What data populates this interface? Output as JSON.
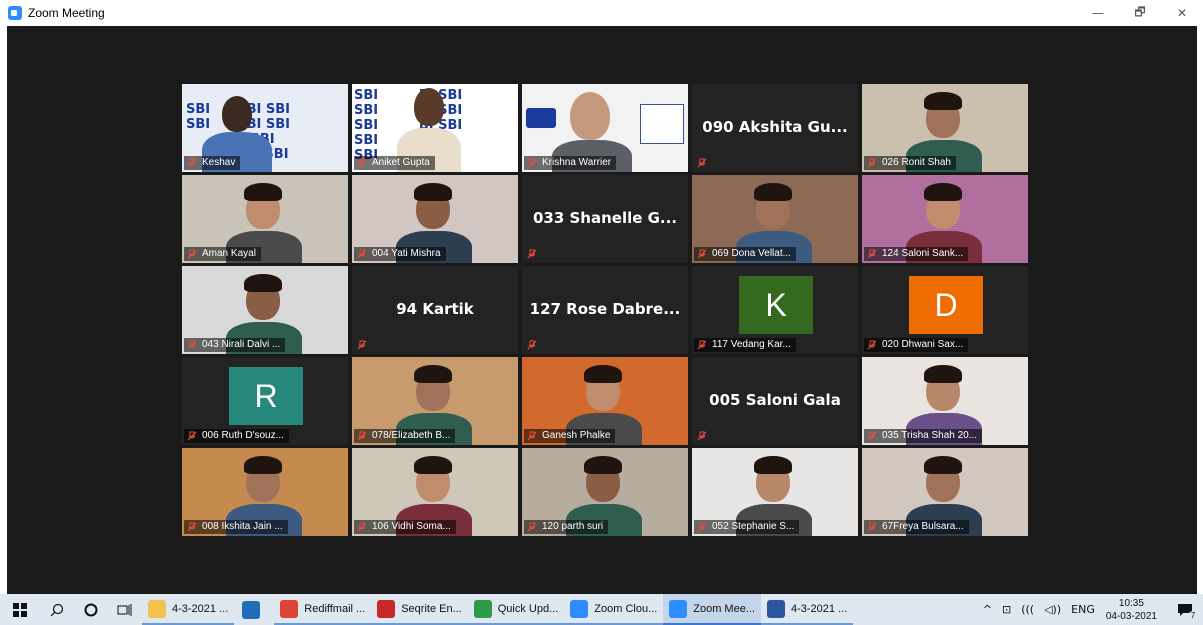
{
  "window": {
    "title": "Zoom Meeting",
    "minimize": "—",
    "restore": "🗗",
    "close": "✕"
  },
  "participants": [
    {
      "name": "Keshav",
      "type": "video",
      "bg": "#e8ecf4"
    },
    {
      "name": "Aniket Gupta",
      "type": "video",
      "bg": "#ffffff"
    },
    {
      "name": "Krishna Warrier",
      "type": "video",
      "bg": "#f2f2f2",
      "active": true
    },
    {
      "name": "090 Akshita Gu...",
      "type": "name"
    },
    {
      "name": "026 Ronit Shah",
      "type": "video",
      "bg": "#cbbfae"
    },
    {
      "name": "Aman Kayal",
      "type": "video",
      "bg": "#c9c3b9"
    },
    {
      "name": "004 Yati Mishra",
      "type": "video",
      "bg": "#d2c6c3"
    },
    {
      "name": "033 Shanelle G...",
      "type": "name"
    },
    {
      "name": "069 Dona Vellat...",
      "type": "video",
      "bg": "#8d6a55"
    },
    {
      "name": "124 Saloni Sank...",
      "type": "video",
      "bg": "#b06f9e"
    },
    {
      "name": "043 Nirali Dalvi ...",
      "type": "video",
      "bg": "#d9d9d9"
    },
    {
      "name": "94 Kartik",
      "type": "name"
    },
    {
      "name": "127 Rose Dabre...",
      "type": "name"
    },
    {
      "name": "117 Vedang Kar...",
      "type": "initial",
      "initial": "K",
      "color": "#33691e"
    },
    {
      "name": "020 Dhwani Sax...",
      "type": "initial",
      "initial": "D",
      "color": "#ef6c00"
    },
    {
      "name": "006 Ruth D'souz...",
      "type": "initial",
      "initial": "R",
      "color": "#26897c"
    },
    {
      "name": "078/Elizabeth B...",
      "type": "video",
      "bg": "#c89b6e"
    },
    {
      "name": "Ganesh Phalke",
      "type": "video",
      "bg": "#d26a2e"
    },
    {
      "name": "005 Saloni Gala",
      "type": "name"
    },
    {
      "name": "035 Trisha Shah 20...",
      "type": "video",
      "bg": "#e9e4df"
    },
    {
      "name": "008 Ikshita Jain ...",
      "type": "video",
      "bg": "#c58a4d"
    },
    {
      "name": "106 Vidhi Soma...",
      "type": "video",
      "bg": "#cfc7b8"
    },
    {
      "name": "120 parth suri",
      "type": "video",
      "bg": "#b6ad9e"
    },
    {
      "name": "052 Stephanie S...",
      "type": "video",
      "bg": "#e8e6e4"
    },
    {
      "name": "67Freya Bulsara...",
      "type": "video",
      "bg": "#d3c8bf"
    }
  ],
  "sbi_tiles": {
    "keshav": "SBI      SBI SBI\nSBI      SBI SBI\n          BI SBI\n           SBI SBI",
    "aniket": "SBI         BI SBI\nSBI         BI SBI\nSBI         BI SBI\nSBI           SBI\nSBI           SBI"
  },
  "taskbar": {
    "apps": [
      {
        "label": "4-3-2021 ...",
        "icon": "folder-icon",
        "color": "#f2c14e",
        "state": "running"
      },
      {
        "label": "",
        "icon": "app-icon",
        "color": "#1e6fb8",
        "state": "pinned"
      },
      {
        "label": "Rediffmail ...",
        "icon": "chrome-icon",
        "color": "#db4437",
        "state": "running"
      },
      {
        "label": "Seqrite En...",
        "icon": "seqrite-icon",
        "color": "#c62828",
        "state": "running"
      },
      {
        "label": "Quick Upd...",
        "icon": "update-icon",
        "color": "#2e9b47",
        "state": "running"
      },
      {
        "label": "Zoom Clou...",
        "icon": "zoom-icon",
        "color": "#2d8cff",
        "state": "running"
      },
      {
        "label": "Zoom Mee...",
        "icon": "zoom-icon",
        "color": "#2d8cff",
        "state": "active"
      },
      {
        "label": "4-3-2021 ...",
        "icon": "word-icon",
        "color": "#2b579a",
        "state": "running"
      }
    ],
    "tray_language": "ENG",
    "time": "10:35",
    "date": "04-03-2021",
    "notification_count": "7"
  }
}
